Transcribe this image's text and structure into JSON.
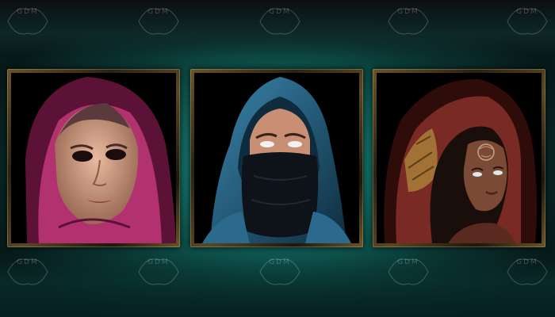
{
  "watermark": {
    "text": "GDM"
  },
  "portraits": [
    {
      "id": "pink-hood",
      "hood_color": "#b2326f",
      "hood_shadow": "#5c1237",
      "skin": "#d9a58b",
      "eye": "#1a0d0d"
    },
    {
      "id": "blue-hood",
      "hood_color": "#2b6a8c",
      "hood_shadow": "#0e2c3e",
      "skin": "#c98f74",
      "eye": "#f2f2f2",
      "mask_color": "#0d1318"
    },
    {
      "id": "red-hood",
      "hood_color": "#7a2a24",
      "hood_shadow": "#2e0c0a",
      "skin": "#7a4a35",
      "eye": "#dfe8e8",
      "pattern_color": "#b08a3c"
    }
  ]
}
